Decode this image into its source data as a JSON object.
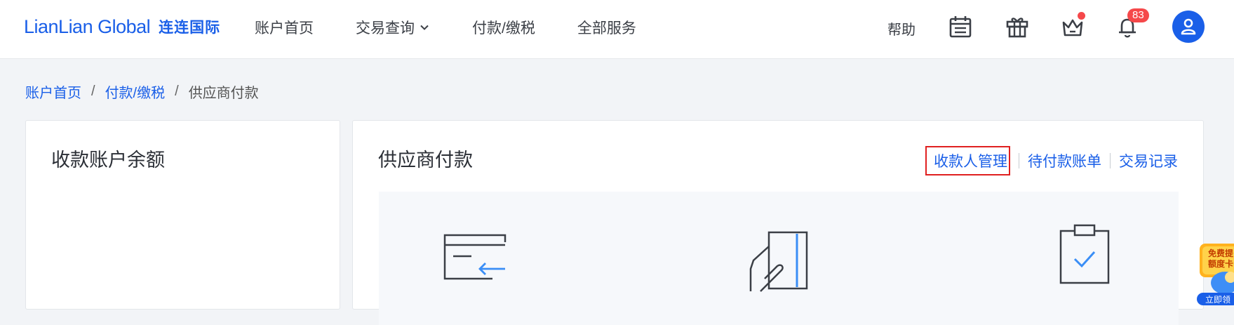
{
  "brand": {
    "name_en": "LianLian Global",
    "name_cn": "连连国际",
    "color": "#1a5fe8"
  },
  "nav": [
    {
      "label": "账户首页",
      "has_dropdown": false
    },
    {
      "label": "交易查询",
      "has_dropdown": true
    },
    {
      "label": "付款/缴税",
      "has_dropdown": false
    },
    {
      "label": "全部服务",
      "has_dropdown": false
    }
  ],
  "header": {
    "help_label": "帮助",
    "icons": [
      "calendar-icon",
      "gift-icon",
      "crown-icon",
      "bell-icon",
      "user-icon"
    ],
    "notification_count": "83",
    "accent_red": "#f5484a"
  },
  "breadcrumb": [
    {
      "label": "账户首页",
      "link": true
    },
    {
      "label": "付款/缴税",
      "link": true
    },
    {
      "label": "供应商付款",
      "link": false
    }
  ],
  "breadcrumb_sep": "/",
  "left_card": {
    "title": "收款账户余额"
  },
  "right_card": {
    "title": "供应商付款",
    "links": [
      {
        "label": "收款人管理",
        "highlighted": true
      },
      {
        "label": "待付款账单",
        "highlighted": false
      },
      {
        "label": "交易记录",
        "highlighted": false
      }
    ],
    "feature_icons": [
      "card-transfer-icon",
      "card-hand-icon",
      "clipboard-check-icon"
    ]
  },
  "float_widget": {
    "line1": "免费提",
    "line2": "额度卡",
    "line3": "立即领"
  }
}
